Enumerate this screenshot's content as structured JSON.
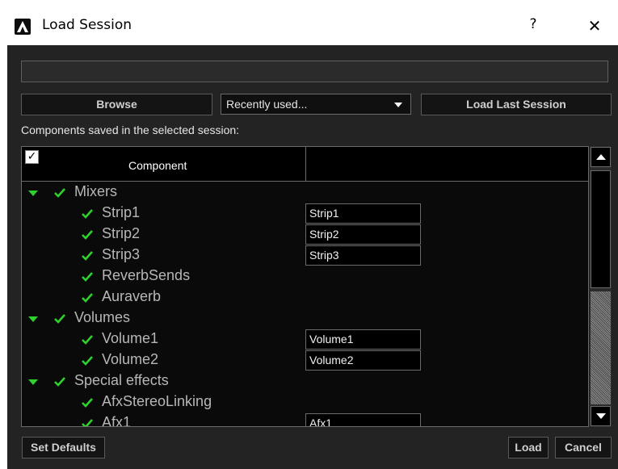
{
  "window": {
    "title": "Load Session",
    "help": "?",
    "close": "✕"
  },
  "path_value": "",
  "buttons": {
    "browse": "Browse",
    "load_last": "Load Last Session",
    "set_defaults": "Set Defaults",
    "load": "Load",
    "cancel": "Cancel"
  },
  "dropdown": {
    "selected": "Recently used..."
  },
  "components_label": "Components saved in the selected session:",
  "header": {
    "checkbox": "✓",
    "column": "Component"
  },
  "tree": [
    {
      "label": "Mixers",
      "value": ""
    },
    {
      "label": "Strip1",
      "value": "Strip1"
    },
    {
      "label": "Strip2",
      "value": "Strip2"
    },
    {
      "label": "Strip3",
      "value": "Strip3"
    },
    {
      "label": "ReverbSends",
      "value": ""
    },
    {
      "label": "Auraverb",
      "value": ""
    },
    {
      "label": "Volumes",
      "value": ""
    },
    {
      "label": "Volume1",
      "value": "Volume1"
    },
    {
      "label": "Volume2",
      "value": "Volume2"
    },
    {
      "label": "Special effects",
      "value": ""
    },
    {
      "label": "AfxStereoLinking",
      "value": ""
    },
    {
      "label": "Afx1",
      "value": "Afx1"
    }
  ],
  "colors": {
    "accent_green": "#2ed12e",
    "panel_bg": "#232323",
    "text_gray": "#b7b7b7"
  }
}
